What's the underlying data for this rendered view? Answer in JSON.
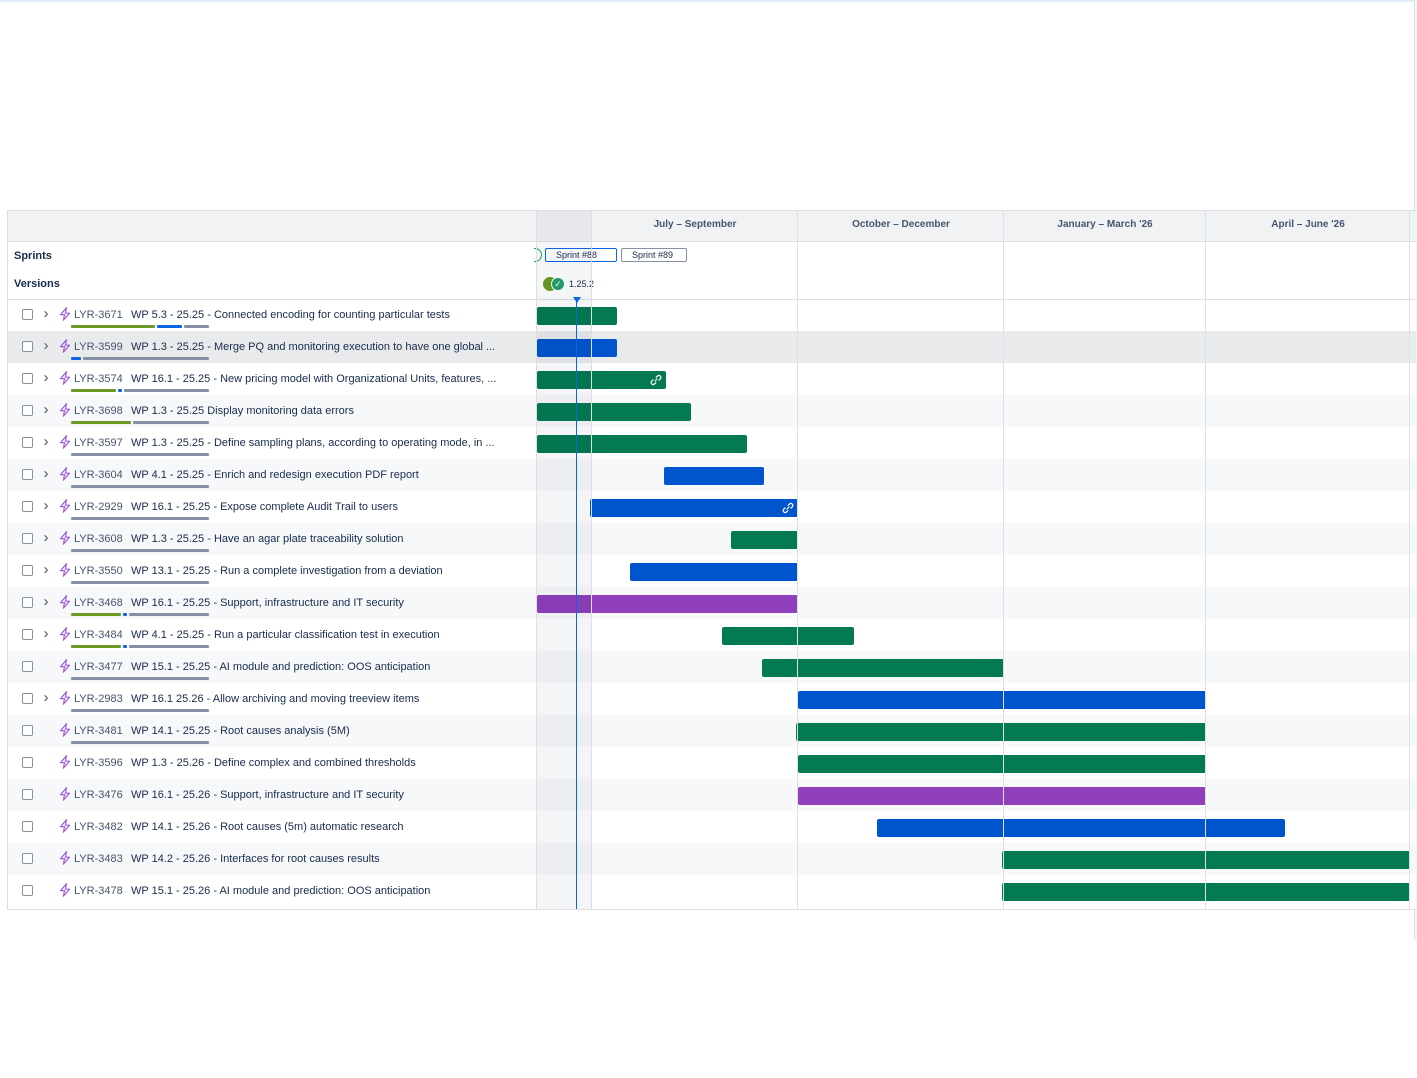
{
  "timeline": {
    "quarters": [
      "July – September",
      "October – December",
      "January – March '26",
      "April – June '26"
    ]
  },
  "sprints": {
    "label": "Sprints",
    "items": [
      "Sprint #88",
      "Sprint #89"
    ]
  },
  "versions": {
    "label": "Versions",
    "release": "1.25.2",
    "release_icon": "check-icon"
  },
  "colors": {
    "green": "#047a52",
    "blue": "#0055cc",
    "purple": "#8f3fba",
    "today": "#0c66e4"
  },
  "rows": [
    {
      "key": "LYR-3671",
      "title": "WP 5.3 - 25.25 - Connected encoding for counting particular tests",
      "bar": "green"
    },
    {
      "key": "LYR-3599",
      "title": "WP 1.3 - 25.25 - Merge PQ and monitoring execution to have one global ...",
      "bar": "blue"
    },
    {
      "key": "LYR-3574",
      "title": "WP 16.1 - 25.25 - New pricing model with Organizational Units, features, ...",
      "bar": "green",
      "linked": true
    },
    {
      "key": "LYR-3698",
      "title": "WP 1.3 - 25.25 Display monitoring data errors",
      "bar": "green"
    },
    {
      "key": "LYR-3597",
      "title": "WP 1.3 - 25.25 - Define sampling plans, according to operating mode, in ...",
      "bar": "green"
    },
    {
      "key": "LYR-3604",
      "title": "WP 4.1 - 25.25 - Enrich and redesign execution PDF report",
      "bar": "blue"
    },
    {
      "key": "LYR-2929",
      "title": "WP 16.1 - 25.25 - Expose complete Audit Trail to users",
      "bar": "blue",
      "linked": true
    },
    {
      "key": "LYR-3608",
      "title": "WP 1.3 - 25.25 - Have an agar plate traceability solution",
      "bar": "green"
    },
    {
      "key": "LYR-3550",
      "title": "WP 13.1 - 25.25 - Run a complete investigation from a deviation",
      "bar": "blue"
    },
    {
      "key": "LYR-3468",
      "title": "WP 16.1 - 25.25 - Support, infrastructure and IT security",
      "bar": "purple"
    },
    {
      "key": "LYR-3484",
      "title": "WP 4.1 - 25.25 - Run a particular classification test in execution",
      "bar": "green"
    },
    {
      "key": "LYR-3477",
      "title": "WP 15.1 - 25.25 - AI module and prediction: OOS anticipation",
      "bar": "green"
    },
    {
      "key": "LYR-2983",
      "title": "WP 16.1 25.26 - Allow archiving and moving treeview items",
      "bar": "blue"
    },
    {
      "key": "LYR-3481",
      "title": "WP 14.1 - 25.25 - Root causes analysis (5M)",
      "bar": "green"
    },
    {
      "key": "LYR-3596",
      "title": "WP 1.3 - 25.26 - Define complex and combined thresholds",
      "bar": "green"
    },
    {
      "key": "LYR-3476",
      "title": "WP 16.1 - 25.26 - Support, infrastructure and IT security",
      "bar": "purple"
    },
    {
      "key": "LYR-3482",
      "title": "WP 14.1 - 25.26 - Root causes (5m) automatic research",
      "bar": "blue"
    },
    {
      "key": "LYR-3483",
      "title": "WP 14.2 - 25.26 - Interfaces for root causes results",
      "bar": "green"
    },
    {
      "key": "LYR-3478",
      "title": "WP 15.1 - 25.26 - AI module and prediction: OOS anticipation",
      "bar": "green"
    }
  ]
}
